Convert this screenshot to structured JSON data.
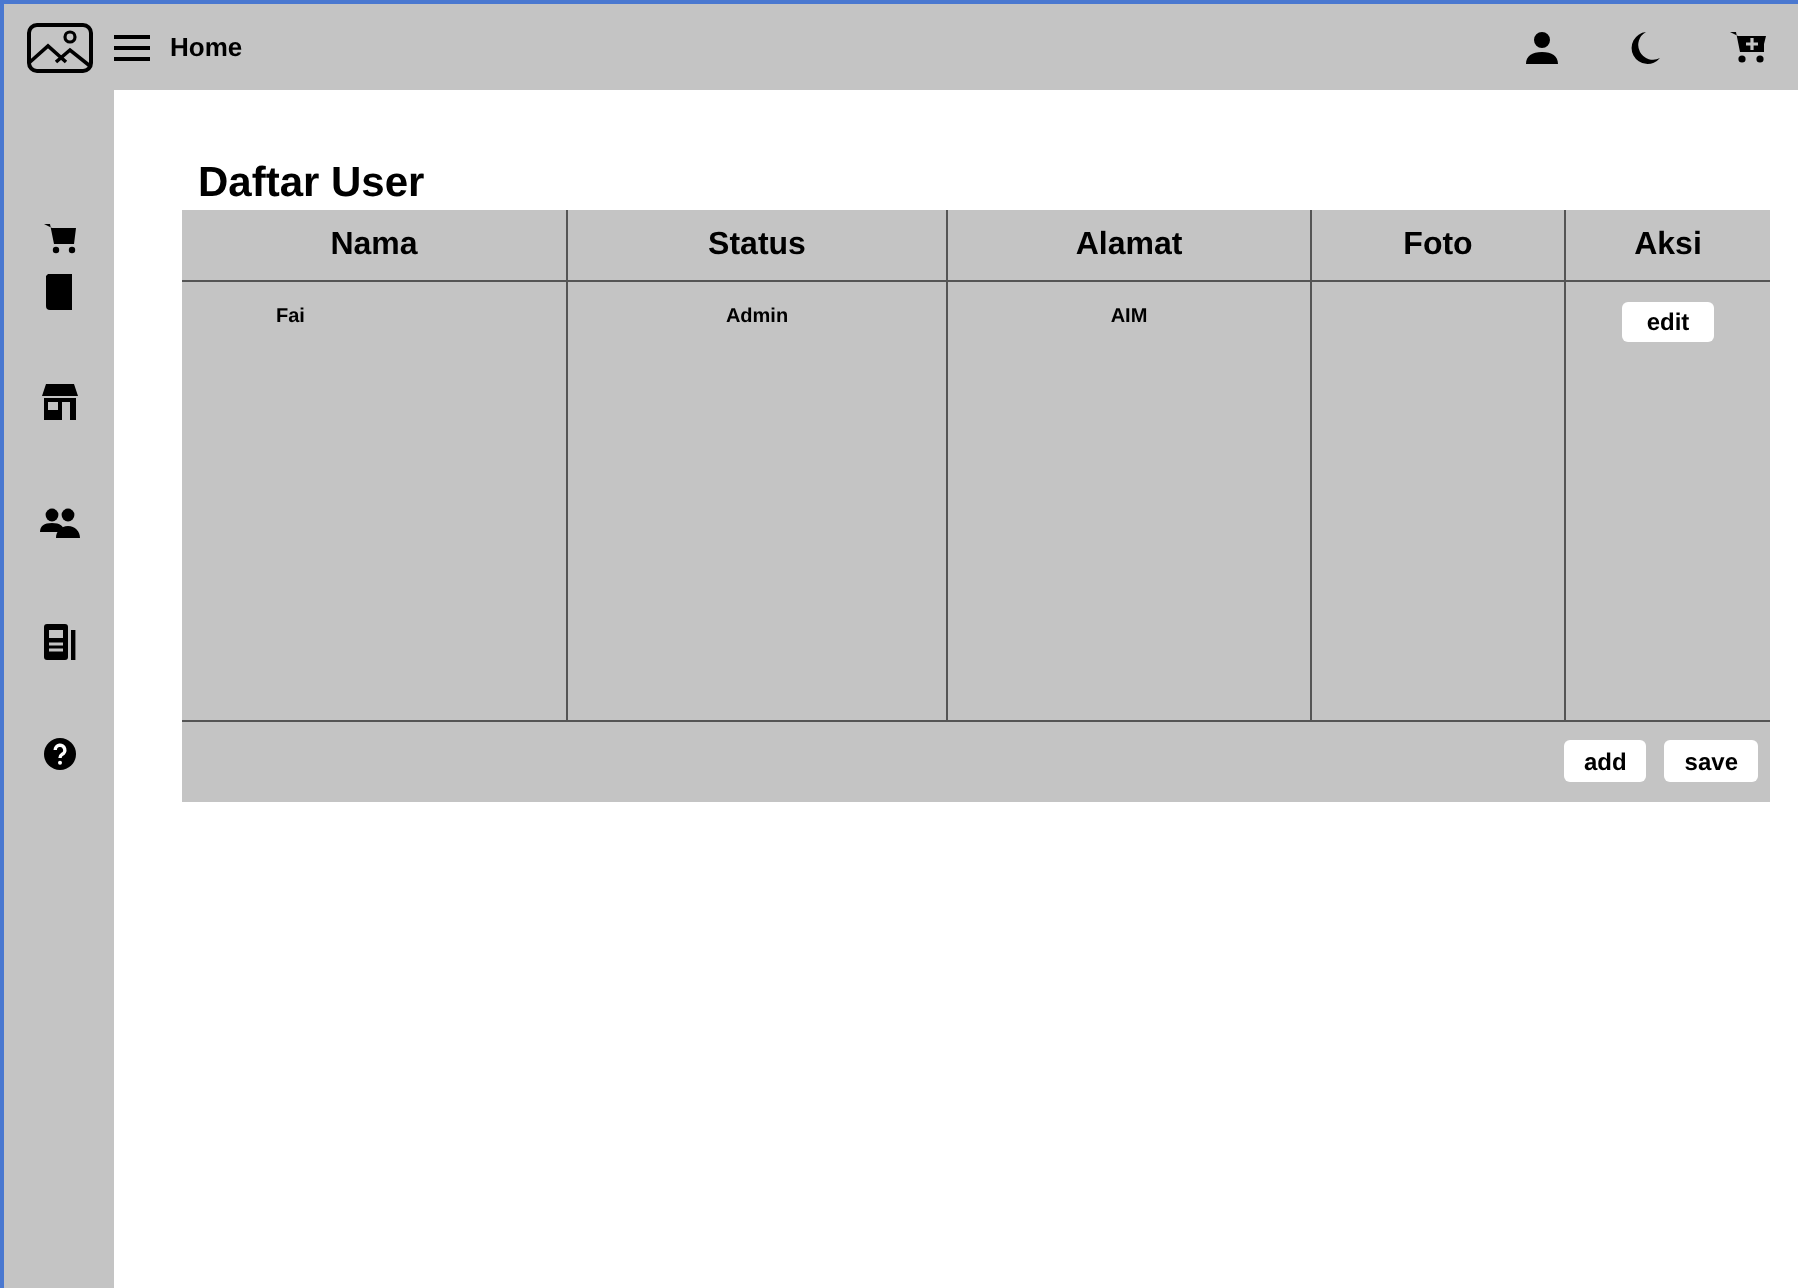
{
  "topbar": {
    "title": "Home"
  },
  "sidebar": {
    "items": [
      {
        "kind": "cart"
      },
      {
        "kind": "book"
      },
      {
        "kind": "store"
      },
      {
        "kind": "people"
      },
      {
        "kind": "news"
      },
      {
        "kind": "help"
      }
    ]
  },
  "page": {
    "title": "Daftar User"
  },
  "table": {
    "columns": [
      "Nama",
      "Status",
      "Alamat",
      "Foto",
      "Aksi"
    ],
    "rows": [
      {
        "cells": [
          "Fai",
          "Admin",
          "AIM"
        ],
        "action": "edit"
      }
    ]
  },
  "buttons": [
    "add",
    "save"
  ]
}
